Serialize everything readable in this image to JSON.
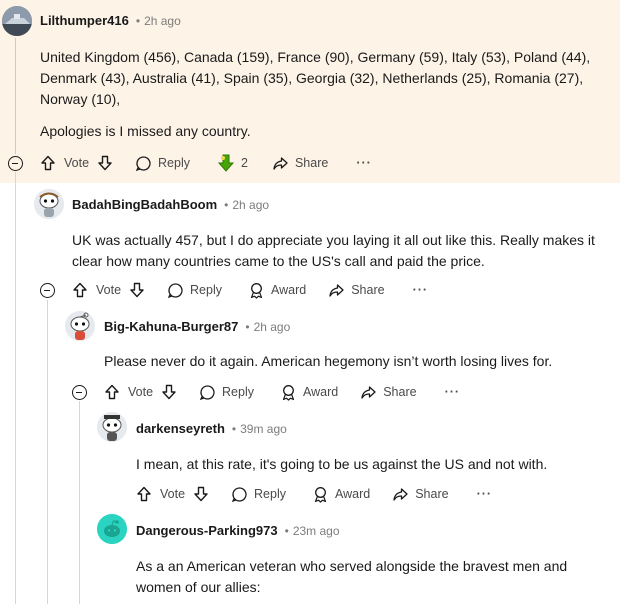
{
  "comments": [
    {
      "author": "Lilthumper416",
      "time": "2h ago",
      "body": [
        "United Kingdom (456), Canada (159), France (90), Germany (59), Italy (53), Poland (44), Denmark (43), Australia (41), Spain (35), Georgia (32), Netherlands (25), Romania (27), Norway (10),",
        "Apologies is I missed any country."
      ],
      "vote_label": "Vote",
      "reply_label": "Reply",
      "award_count": "2",
      "share_label": "Share"
    },
    {
      "author": "BadahBingBadahBoom",
      "time": "2h ago",
      "body": "UK was actually 457, but I do appreciate you laying it all out like this. Really makes it clear how many countries came to the US's call and paid the price.",
      "vote_label": "Vote",
      "reply_label": "Reply",
      "award_label": "Award",
      "share_label": "Share"
    },
    {
      "author": "Big-Kahuna-Burger87",
      "time": "2h ago",
      "body": "Please never do it again. American hegemony isn’t worth losing lives for.",
      "vote_label": "Vote",
      "reply_label": "Reply",
      "award_label": "Award",
      "share_label": "Share"
    },
    {
      "author": "darkenseyreth",
      "time": "39m ago",
      "body": "I mean, at this rate, it's going to be us against the US and not with.",
      "vote_label": "Vote",
      "reply_label": "Reply",
      "award_label": "Award",
      "share_label": "Share"
    },
    {
      "author": "Dangerous-Parking973",
      "time": "23m ago",
      "body": "As a an American veteran who served alongside the bravest men and women of our allies:"
    }
  ],
  "separator": "•",
  "more_label": "···",
  "colors": {
    "highlight": "#fdf3e7",
    "thread_line": "#d6d6d6",
    "award_green": "#46a508",
    "avatar_teal": "#2ad4c0"
  }
}
